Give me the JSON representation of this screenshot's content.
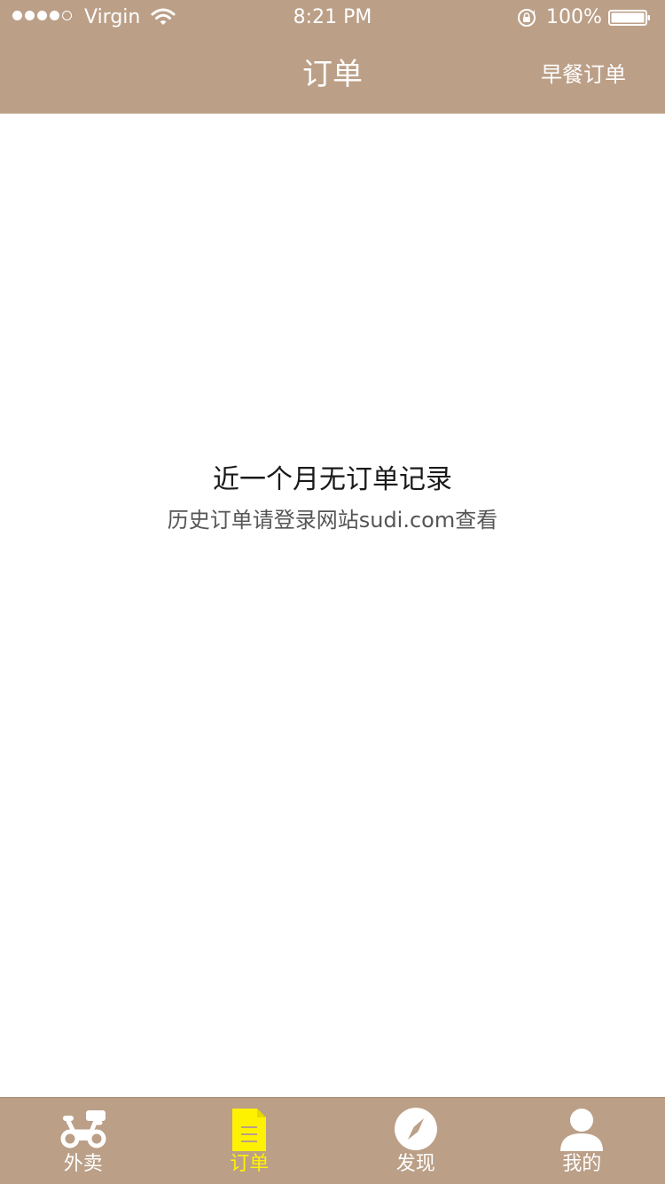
{
  "status_bar": {
    "carrier": "Virgin",
    "time": "8:21 PM",
    "battery": "100%"
  },
  "nav": {
    "title": "订单",
    "right_button": "早餐订单"
  },
  "empty_state": {
    "title": "近一个月无订单记录",
    "subtitle": "历史订单请登录网站sudi.com查看"
  },
  "tabs": [
    {
      "label": "外卖",
      "icon": "scooter-icon",
      "active": false
    },
    {
      "label": "订单",
      "icon": "order-document-icon",
      "active": true
    },
    {
      "label": "发现",
      "icon": "compass-icon",
      "active": false
    },
    {
      "label": "我的",
      "icon": "profile-icon",
      "active": false
    }
  ],
  "colors": {
    "brand": "#bb9f87",
    "active_tab": "#fff200",
    "text_on_brand": "#ffffff"
  }
}
